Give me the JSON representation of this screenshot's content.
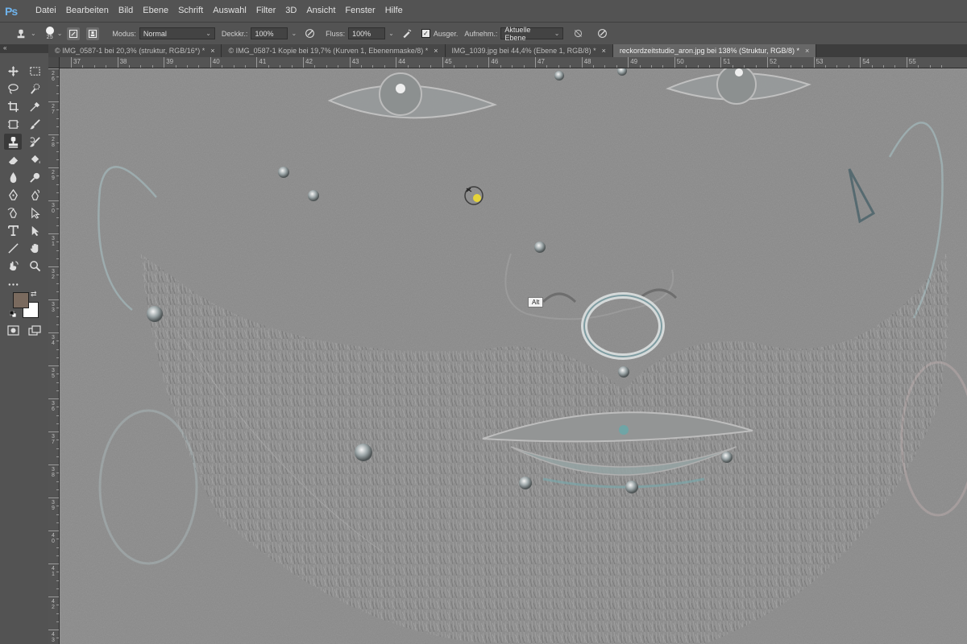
{
  "app": {
    "logo": "Ps"
  },
  "menu": [
    "Datei",
    "Bearbeiten",
    "Bild",
    "Ebene",
    "Schrift",
    "Auswahl",
    "Filter",
    "3D",
    "Ansicht",
    "Fenster",
    "Hilfe"
  ],
  "options": {
    "brush_size": "25",
    "mode_label": "Modus:",
    "mode_value": "Normal",
    "opacity_label": "Deckkr.:",
    "opacity_value": "100%",
    "flow_label": "Fluss:",
    "flow_value": "100%",
    "aligned_label": "Ausger.",
    "sample_label": "Aufnehm.:",
    "sample_value": "Aktuelle Ebene"
  },
  "tabs": [
    {
      "label": "© IMG_0587-1 bei 20,3% (struktur, RGB/16*) *",
      "close": "×",
      "active": false
    },
    {
      "label": "© IMG_0587-1 Kopie bei 19,7% (Kurven 1, Ebenenmaske/8) *",
      "close": "×",
      "active": false
    },
    {
      "label": "IMG_1039.jpg bei 44,4% (Ebene 1, RGB/8) *",
      "close": "×",
      "active": false
    },
    {
      "label": "reckordzeitstudio_aron.jpg bei 138% (Struktur, RGB/8) *",
      "close": "×",
      "active": true
    }
  ],
  "ruler_top_numbers": [
    "37",
    "38",
    "39",
    "40",
    "41",
    "42",
    "43",
    "44",
    "45",
    "46",
    "47",
    "48",
    "49",
    "50",
    "51",
    "52",
    "53",
    "54",
    "55"
  ],
  "ruler_left_numbers": [
    "2 6",
    "2 7",
    "2 8",
    "2 9",
    "3 0",
    "3 1",
    "3 2",
    "3 3",
    "3 4",
    "3 5",
    "3 6",
    "3 7",
    "3 8",
    "3 9",
    "4 0",
    "4 1",
    "4 2",
    "4 3"
  ],
  "cursor_tooltip": "Alt",
  "colors": {
    "foreground": "#7a6a5e",
    "background": "#ffffff",
    "canvas": "#8b8b8b",
    "ui_panel": "#535353",
    "cursor_dot": "#e5d43a"
  },
  "toolbar_collapse": "«",
  "tools": [
    "move-icon",
    "marquee-icon",
    "lasso-icon",
    "quick-select-icon",
    "crop-icon",
    "eyedropper-icon",
    "frame-icon",
    "brush-icon",
    "clone-stamp-icon",
    "history-brush-icon",
    "eraser-icon",
    "paint-bucket-icon",
    "blur-icon",
    "dodge-icon",
    "pen-icon",
    "freeform-pen-icon",
    "curvature-pen-icon",
    "direct-select-icon",
    "type-icon",
    "path-select-icon",
    "line-icon",
    "hand-icon",
    "rotate-view-icon",
    "zoom-icon",
    "more-icon"
  ]
}
